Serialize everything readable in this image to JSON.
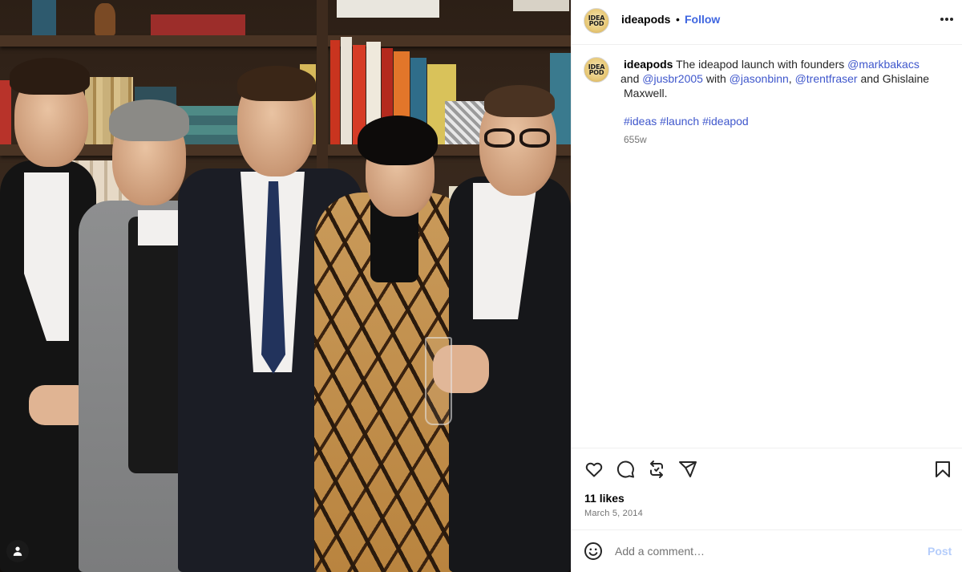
{
  "post": {
    "username": "ideapods",
    "avatar_text": "IDEA POD",
    "follow_label": "Follow",
    "separator": "•",
    "menu_icon": "more-horizontal-icon",
    "photo_alt_icon": "user-tag-icon"
  },
  "caption": {
    "username": "ideapods",
    "text_1": " The ideapod launch with founders ",
    "mention_1": "@markbakacs",
    "text_2": " and ",
    "mention_2": "@jusbr2005",
    "text_3": " with ",
    "mention_3": "@jasonbinn",
    "text_4": ", ",
    "mention_4": "@trentfraser",
    "text_5": " and Ghislaine Maxwell.",
    "hashtags": [
      "#ideas",
      "#launch",
      "#ideapod"
    ],
    "age": "655w"
  },
  "actions": {
    "icons": [
      "heart-icon",
      "comment-icon",
      "repost-icon",
      "share-icon",
      "bookmark-icon"
    ],
    "likes": "11 likes",
    "date": "March 5, 2014"
  },
  "comment": {
    "placeholder": "Add a comment…",
    "post_label": "Post",
    "emoji_icon": "emoji-icon"
  },
  "colors": {
    "link": "#3f57cc",
    "follow": "#3f66e0",
    "post_disabled": "#b5cdfb",
    "muted": "#737373",
    "divider": "#efefef"
  }
}
